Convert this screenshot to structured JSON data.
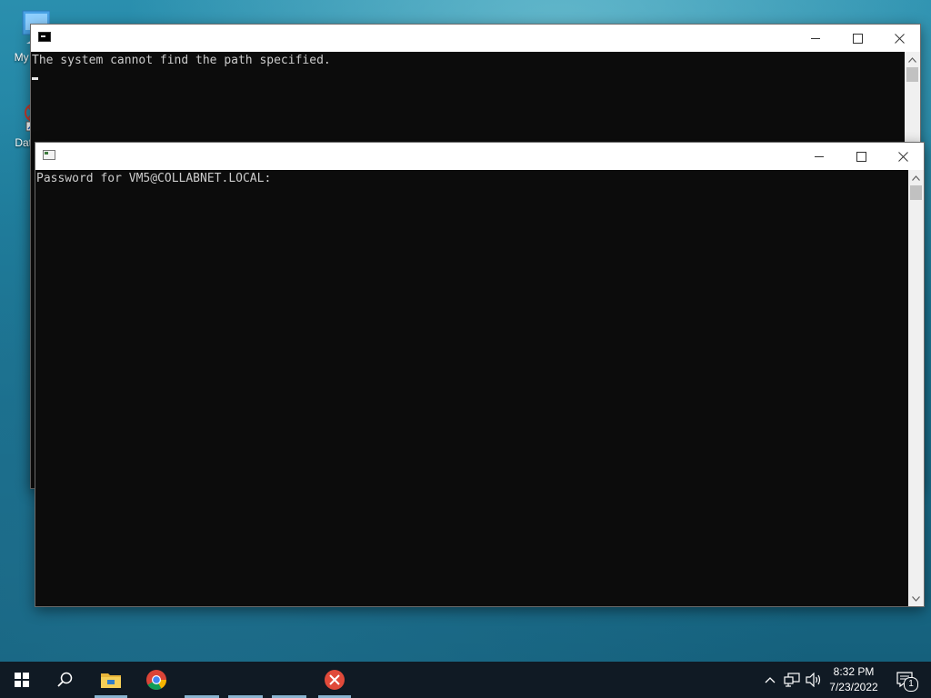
{
  "desktop": {
    "icons": [
      {
        "label": "My Co",
        "icon": "computer-icon"
      },
      {
        "label": "DataV",
        "icon": "shortcut-app-icon"
      }
    ]
  },
  "back_window": {
    "title": "",
    "lines": [
      "The system cannot find the path specified."
    ]
  },
  "front_window": {
    "title": "",
    "lines": [
      "Password for VM5@COLLABNET.LOCAL:"
    ]
  },
  "taskbar": {
    "apps": [
      "start-icon",
      "search-icon",
      "file-explorer-icon",
      "chrome-icon",
      "error-app-icon"
    ],
    "time": "8:32 PM",
    "date": "7/23/2022",
    "notification_count": "1"
  }
}
